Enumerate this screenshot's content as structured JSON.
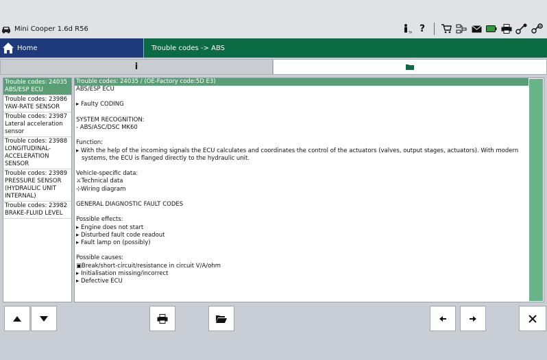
{
  "header": {
    "vehicle": "Mini Cooper 1.6d R56",
    "tool_icons": [
      "person-tm-icon",
      "help-icon",
      "cart-icon",
      "network-icon",
      "mail-icon",
      "battery-icon",
      "printer-icon",
      "key-wrench-icon",
      "key-settings-icon"
    ]
  },
  "nav": {
    "home_label": "Home",
    "breadcrumb": "Trouble codes -> ABS"
  },
  "tabs": {
    "info_label": "i"
  },
  "list": [
    {
      "code": "Trouble codes: 24035",
      "name": "ABS/ESP ECU",
      "selected": true
    },
    {
      "code": "Trouble codes: 23986",
      "name": "YAW-RATE SENSOR",
      "selected": false
    },
    {
      "code": "Trouble codes: 23987",
      "name": "Lateral acceleration sensor",
      "selected": false
    },
    {
      "code": "Trouble codes: 23988",
      "name": "LONGITUDINAL-ACCELERATION SENSOR",
      "selected": false
    },
    {
      "code": "Trouble codes: 23989",
      "name": "PRESSURE SENSOR (HYDRAULIC UNIT INTERNAL)",
      "selected": false
    },
    {
      "code": "Trouble codes: 23982",
      "name": "BRAKE-FLUID LEVEL",
      "selected": false
    }
  ],
  "content": {
    "header": "Trouble codes: 24035 / (OE-Factory code:5D E3)",
    "title": "ABS/ESP ECU",
    "fault": "Faulty CODING",
    "system_recognition_label": "SYSTEM RECOGNITION:",
    "system_recognition_value": "- ABS/ASC/DSC MK60",
    "function_label": "Function:",
    "function_text": "With the help of the incoming signals the ECU calculates and coordinates the control of the actuators (valves, output stages, actuators). With modern systems, the ECU is flanged directly to the hydraulic unit.",
    "vehicle_data_label": "Vehicle-specific data:",
    "technical_data": "Technical data",
    "wiring_diagram": "Wiring diagram",
    "general_codes": "GENERAL DIAGNOSTIC FAULT CODES",
    "effects_label": "Possible effects:",
    "effects": [
      "Engine does not start",
      "Disturbed fault code readout",
      "Fault lamp on (possibly)"
    ],
    "causes_label": "Possible causes:",
    "causes": [
      "Break/short-circuit/resistance in circuit V/A/ohm",
      "Initialisation missing/incorrect",
      "Defective ECU"
    ]
  },
  "colors": {
    "nav_home": "#1f3a7a",
    "nav_crumb": "#0b6b45",
    "selected": "#5a9e76"
  }
}
